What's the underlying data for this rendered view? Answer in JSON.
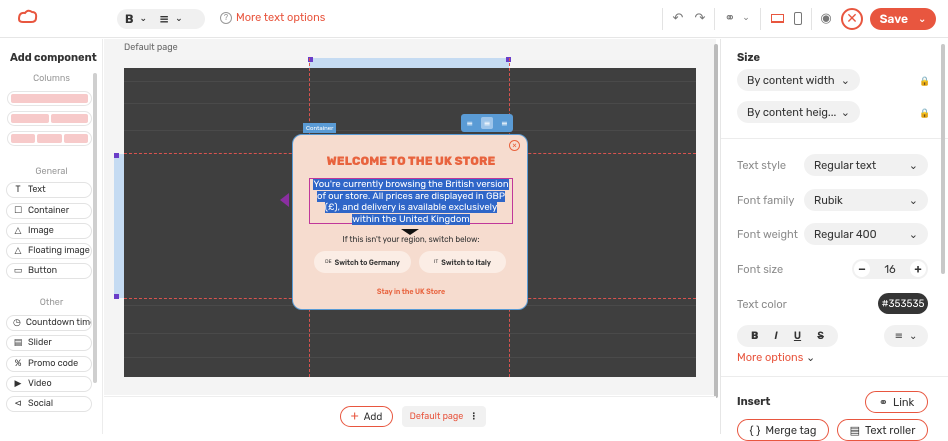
{
  "toolbar": {
    "bold_label": "B",
    "more_text_options": "More text options",
    "save_label": "Save"
  },
  "left_panel": {
    "title": "Add component",
    "columns_heading": "Columns",
    "general_heading": "General",
    "other_heading": "Other",
    "general_items": [
      {
        "label": "Text",
        "icon": "text-icon"
      },
      {
        "label": "Container",
        "icon": "container-icon"
      },
      {
        "label": "Image",
        "icon": "image-icon"
      },
      {
        "label": "Floating image",
        "icon": "floating-image-icon"
      },
      {
        "label": "Button",
        "icon": "button-icon"
      }
    ],
    "other_items": [
      {
        "label": "Countdown timer",
        "icon": "countdown-icon"
      },
      {
        "label": "Slider",
        "icon": "slider-icon"
      },
      {
        "label": "Promo code",
        "icon": "promo-code-icon"
      },
      {
        "label": "Video",
        "icon": "video-icon"
      },
      {
        "label": "Social",
        "icon": "social-icon"
      }
    ]
  },
  "canvas": {
    "page_label": "Default page",
    "container_tag": "Container",
    "popup": {
      "title": "WELCOME TO THE UK STORE",
      "body_lines": [
        "You're currently browsing the British version",
        "of our store. All prices are displayed in GBP",
        "(£), and delivery is available exclusively",
        "within the United Kingdom"
      ],
      "switch_text": "If this isn't your region, switch below:",
      "btn_germany_flag": "DE",
      "btn_germany": "Switch to Germany",
      "btn_italy_flag": "IT",
      "btn_italy": "Switch to Italy",
      "stay_link": "Stay in the UK Store"
    }
  },
  "bottom": {
    "add_label": "Add",
    "page_label": "Default page"
  },
  "right_panel": {
    "size_title": "Size",
    "width_value": "By content width",
    "height_value": "By content heig...",
    "text_style_label": "Text style",
    "text_style_value": "Regular text",
    "font_family_label": "Font family",
    "font_family_value": "Rubik",
    "font_weight_label": "Font weight",
    "font_weight_value": "Regular 400",
    "font_size_label": "Font size",
    "font_size_value": "16",
    "text_color_label": "Text color",
    "text_color_value": "#353535",
    "fmt_bold": "B",
    "fmt_italic": "I",
    "fmt_underline": "U",
    "fmt_strike": "S",
    "more_options": "More options",
    "insert_title": "Insert",
    "link_label": "Link",
    "merge_tag_label": "Merge tag",
    "text_roller_label": "Text roller"
  },
  "colors": {
    "accent": "#e8563f",
    "popup_bg": "#f6dccf",
    "canvas_dark": "#3f3f3f",
    "selection": "#2f66c8"
  }
}
